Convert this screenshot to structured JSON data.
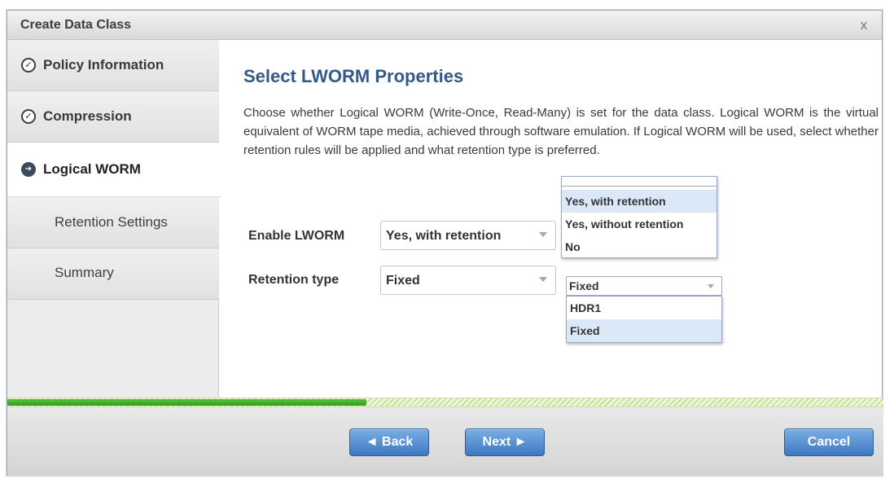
{
  "dialog": {
    "title": "Create Data Class",
    "close_glyph": "x"
  },
  "sidebar": {
    "items": [
      {
        "label": "Policy Information",
        "state": "done",
        "icon": "check-circle-icon",
        "glyph": "✓"
      },
      {
        "label": "Compression",
        "state": "done",
        "icon": "check-circle-icon",
        "glyph": "✓"
      },
      {
        "label": "Logical WORM",
        "state": "active",
        "icon": "arrow-circle-icon",
        "glyph": "➔"
      },
      {
        "label": "Retention Settings",
        "state": "pending"
      },
      {
        "label": "Summary",
        "state": "pending"
      }
    ]
  },
  "main": {
    "heading": "Select LWORM Properties",
    "description": "Choose whether Logical WORM (Write-Once, Read-Many) is set for the data class. Logical WORM is the virtual equivalent of WORM tape media, achieved through software emulation. If Logical WORM will be used, select whether retention rules will be applied and what retention type is preferred.",
    "enable_lworm": {
      "label": "Enable LWORM",
      "value": "Yes, with retention",
      "options": [
        "Yes, with retention",
        "Yes, without retention",
        "No"
      ]
    },
    "retention_type": {
      "label": "Retention type",
      "value": "Fixed",
      "options": [
        "HDR1",
        "Fixed"
      ]
    }
  },
  "progress": {
    "fraction": 0.41,
    "fill_color": "#3aaa24"
  },
  "footer": {
    "back_label": "◄ Back",
    "next_label": "Next ►",
    "cancel_label": "Cancel"
  },
  "colors": {
    "accent": "#335a88",
    "button": "#4a86cc",
    "selection": "#dbe8f8"
  }
}
